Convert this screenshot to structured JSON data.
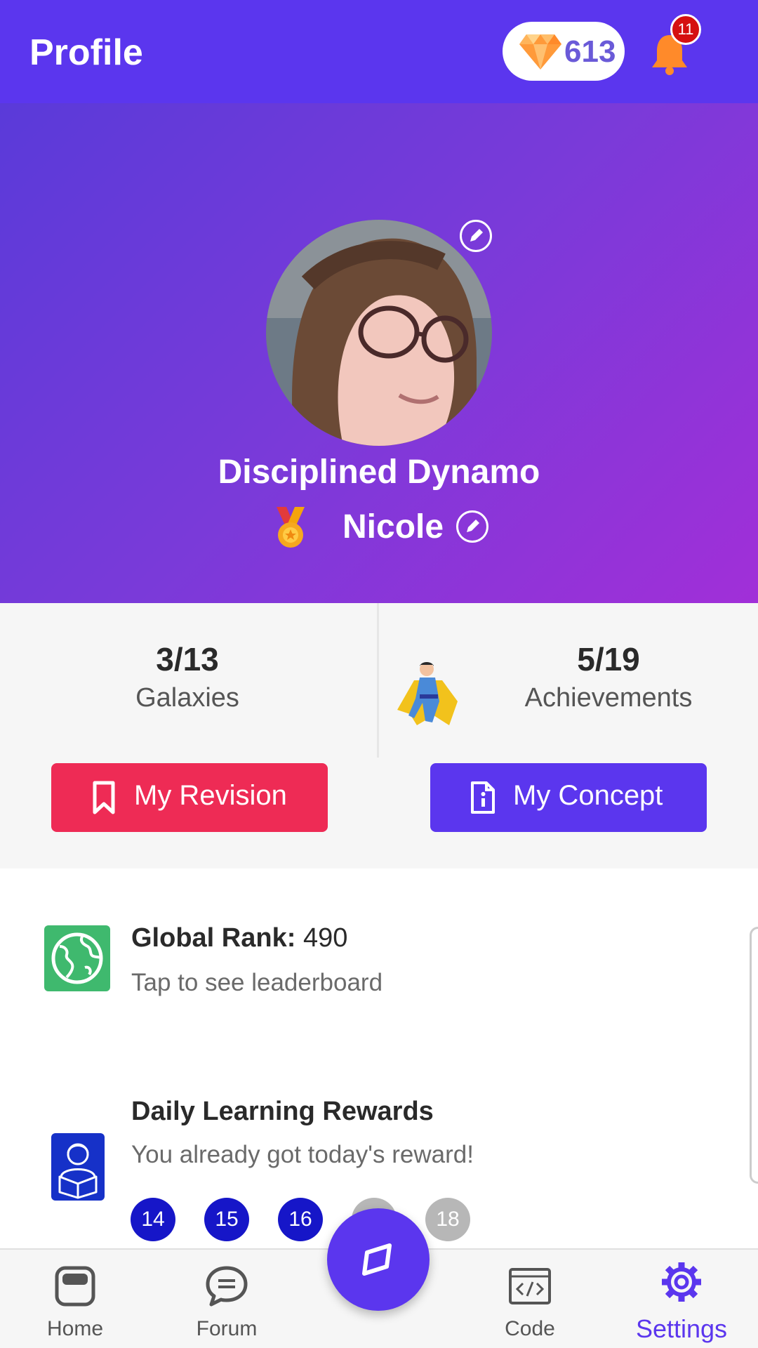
{
  "header": {
    "title": "Profile",
    "gems": "613",
    "notification_count": "11",
    "colors": {
      "bar": "#5b36ee",
      "badge": "#d51010",
      "bell": "#ff8a2a"
    }
  },
  "profile": {
    "rank_title": "Disciplined Dynamo",
    "username": "Nicole"
  },
  "stats": {
    "galaxies": {
      "value": "3/13",
      "label": "Galaxies"
    },
    "achievements": {
      "value": "5/19",
      "label": "Achievements"
    }
  },
  "buttons": {
    "revision": "My Revision",
    "concept": "My Concept"
  },
  "global_rank": {
    "label": "Global Rank:",
    "value": "490",
    "subtitle": "Tap to see leaderboard"
  },
  "daily_rewards": {
    "title": "Daily Learning Rewards",
    "subtitle": "You already got today's reward!",
    "days": [
      {
        "label": "14",
        "state": "done"
      },
      {
        "label": "15",
        "state": "done"
      },
      {
        "label": "16",
        "state": "done"
      },
      {
        "label": "",
        "state": "todo"
      },
      {
        "label": "18",
        "state": "todo"
      }
    ]
  },
  "nav": {
    "home": "Home",
    "forum": "Forum",
    "code": "Code",
    "settings": "Settings",
    "active": "Settings",
    "accent": "#5b36ee"
  }
}
